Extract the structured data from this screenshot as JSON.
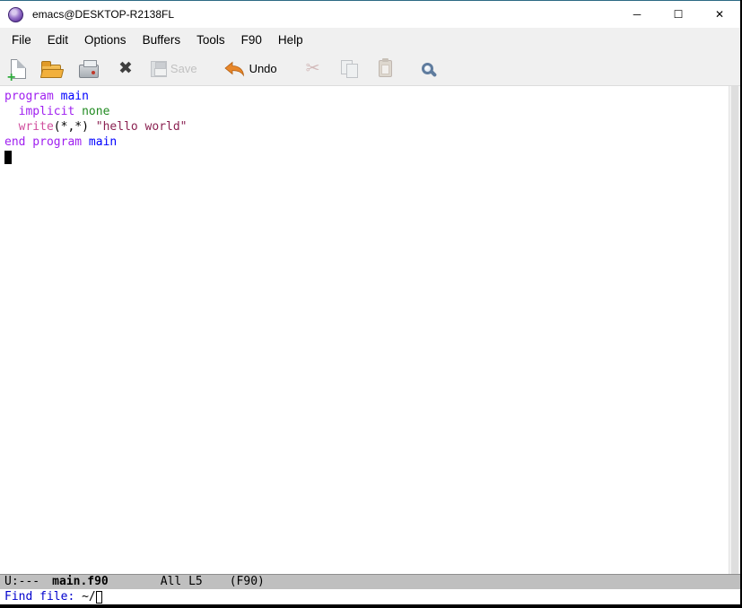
{
  "window": {
    "title": "emacs@DESKTOP-R2138FL",
    "controls": {
      "minimize": "─",
      "maximize": "☐",
      "close": "✕"
    }
  },
  "menu": {
    "items": [
      "File",
      "Edit",
      "Options",
      "Buffers",
      "Tools",
      "F90",
      "Help"
    ]
  },
  "toolbar": {
    "save_label": "Save",
    "undo_label": "Undo",
    "kill_glyph": "✖",
    "cut_glyph": "✂"
  },
  "buffer": {
    "lines": [
      {
        "tokens": [
          {
            "face": "keyword",
            "text": "program"
          },
          {
            "text": " "
          },
          {
            "face": "function",
            "text": "main"
          }
        ]
      },
      {
        "tokens": [
          {
            "text": "  "
          },
          {
            "face": "keyword",
            "text": "implicit"
          },
          {
            "text": " "
          },
          {
            "face": "type",
            "text": "none"
          }
        ]
      },
      {
        "tokens": [
          {
            "text": "  "
          },
          {
            "face": "builtin",
            "text": "write"
          },
          {
            "text": "(*,*) "
          },
          {
            "face": "string",
            "text": "\"hello world\""
          }
        ]
      },
      {
        "tokens": [
          {
            "face": "keyword",
            "text": "end program"
          },
          {
            "text": " "
          },
          {
            "face": "function",
            "text": "main"
          }
        ]
      },
      {
        "tokens": [],
        "cursor": true
      }
    ]
  },
  "modeline": {
    "flags": "U:---",
    "buffer_name": "main.f90",
    "position": "All L5",
    "mode": "(F90)"
  },
  "minibuffer": {
    "prompt": "Find file: ",
    "input": "~/"
  },
  "colors": {
    "faces": {
      "keyword": "#a020f0",
      "function": "#0000ff",
      "type": "#228b22",
      "builtin": "#d04f9e",
      "string": "#8b2252",
      "default": "#000000"
    },
    "minibuffer_prompt": "#0000cd",
    "modeline_bg": "#bfbfbf"
  }
}
